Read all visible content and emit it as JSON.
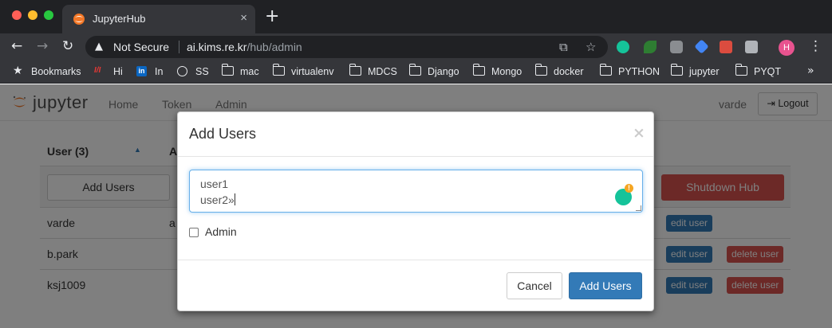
{
  "browser": {
    "tab_title": "JupyterHub",
    "tab_close": "×",
    "new_tab": "+",
    "security_label": "Not Secure",
    "url_host": "ai.kims.re.kr",
    "url_path": "/hub/admin",
    "profile_initial": "H",
    "bookmarks": [
      {
        "label": "Bookmarks",
        "icon": "star-icon"
      },
      {
        "label": "Hi",
        "icon": "hi-icon"
      },
      {
        "label": "In",
        "icon": "linkedin-icon"
      },
      {
        "label": "SS",
        "icon": "globe-icon"
      },
      {
        "label": "mac",
        "icon": "folder-icon"
      },
      {
        "label": "virtualenv",
        "icon": "folder-icon"
      },
      {
        "label": "MDCS",
        "icon": "folder-icon"
      },
      {
        "label": "Django",
        "icon": "folder-icon"
      },
      {
        "label": "Mongo",
        "icon": "folder-icon"
      },
      {
        "label": "docker",
        "icon": "folder-icon"
      },
      {
        "label": "PYTHON",
        "icon": "folder-icon"
      },
      {
        "label": "jupyter",
        "icon": "folder-icon"
      },
      {
        "label": "PYQT",
        "icon": "folder-icon"
      }
    ],
    "bookmarks_overflow": "»"
  },
  "jupyter": {
    "logo_text": "jupyter",
    "nav": [
      "Home",
      "Token",
      "Admin"
    ],
    "username": "varde",
    "logout_label": "Logout"
  },
  "admin": {
    "headers": {
      "user": "User (3)",
      "admin": "A"
    },
    "add_users_label": "Add Users",
    "shutdown_label": "Shutdown Hub",
    "edit_label": "edit user",
    "delete_label": "delete user",
    "users": [
      {
        "name": "varde",
        "admin": "a"
      },
      {
        "name": "b.park",
        "admin": ""
      },
      {
        "name": "ksj1009",
        "admin": ""
      }
    ]
  },
  "modal": {
    "title": "Add Users",
    "close": "×",
    "userlist": [
      "user1",
      "user2»"
    ],
    "admin_label": "Admin",
    "admin_checked": false,
    "cancel_label": "Cancel",
    "confirm_label": "Add Users"
  },
  "colors": {
    "primary": "#337ab7",
    "danger": "#d9534f",
    "chrome_dark": "#202124",
    "chrome_toolbar": "#35363a",
    "jupyter_orange": "#f37726"
  }
}
